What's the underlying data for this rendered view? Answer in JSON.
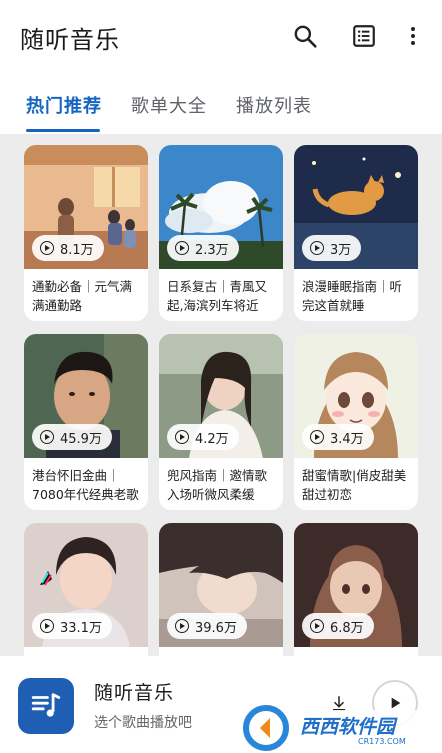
{
  "app": {
    "title": "随听音乐"
  },
  "toolbar": {
    "icons": [
      "search-icon",
      "list-icon",
      "more-vertical-icon"
    ]
  },
  "tabs": [
    {
      "label": "热门推荐",
      "active": true
    },
    {
      "label": "歌单大全",
      "active": false
    },
    {
      "label": "播放列表",
      "active": false
    }
  ],
  "playlists": [
    {
      "plays": "8.1万",
      "title": "通勤必备｜元气满满通勤路"
    },
    {
      "plays": "2.3万",
      "title": "日系复古｜青風又起,海滨列车将近"
    },
    {
      "plays": "3万",
      "title": "浪漫睡眠指南｜听完这首就睡"
    },
    {
      "plays": "45.9万",
      "title": "港台怀旧金曲｜7080年代经典老歌"
    },
    {
      "plays": "4.2万",
      "title": "兜风指南｜邀情歌入场听微风柔缓"
    },
    {
      "plays": "3.4万",
      "title": "甜蜜情歌|俏皮甜美甜过初恋"
    },
    {
      "plays": "33.1万",
      "title": ""
    },
    {
      "plays": "39.6万",
      "title": ""
    },
    {
      "plays": "6.8万",
      "title": ""
    }
  ],
  "now_playing": {
    "title": "随听音乐",
    "subtitle": "选个歌曲播放吧"
  },
  "watermark": {
    "text": "西西软件园",
    "sub": "CR173.COM"
  },
  "colors": {
    "accent": "#1565c0",
    "album": "#1e5fb4",
    "background": "#ececec"
  }
}
